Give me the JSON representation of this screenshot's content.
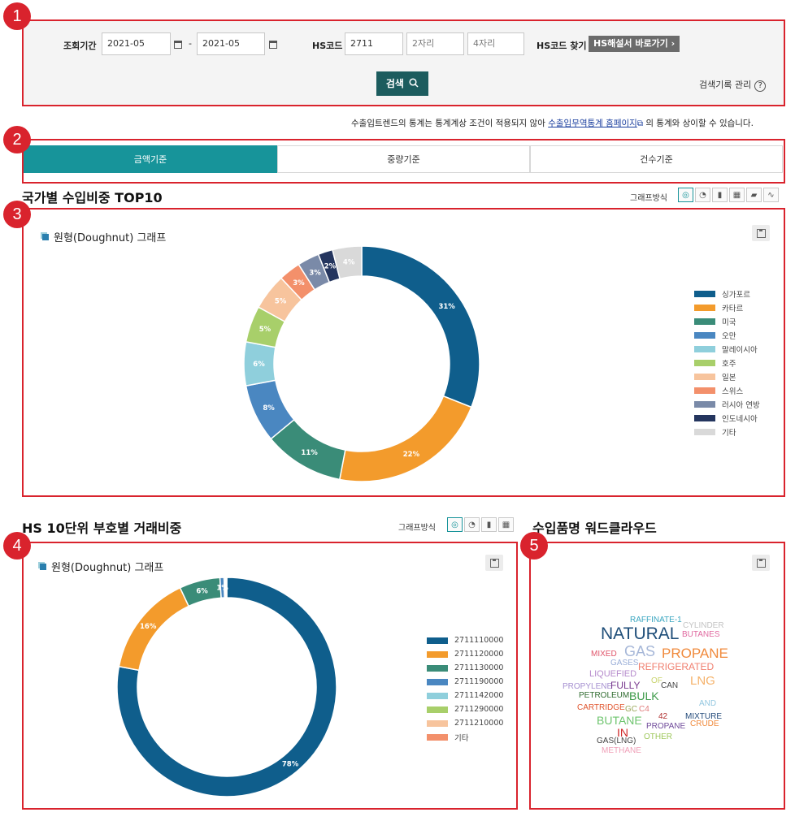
{
  "search": {
    "period_label": "조회기간",
    "date_from": "2021-05",
    "date_sep": "-",
    "date_to": "2021-05",
    "hs_label": "HS코드",
    "hs_value": "2711",
    "hs_2_placeholder": "2자리",
    "hs_4_placeholder": "4자리",
    "hs_find_label": "HS코드 찾기",
    "hs_guide_button": "HS해설서 바로가기 ›",
    "search_button": "검색",
    "history_link": "검색기록 관리",
    "help_glyph": "?"
  },
  "notice": {
    "prefix": "수출입트렌드의 통계는 통계계상 조건이 적용되지 않아",
    "link": "수출입무역통계 홈페이지",
    "suffix": "의 통계와 상이할 수 있습니다."
  },
  "tabs": [
    {
      "label": "금액기준",
      "active": true
    },
    {
      "label": "중량기준",
      "active": false
    },
    {
      "label": "건수기준",
      "active": false
    }
  ],
  "markers": [
    "1",
    "2",
    "3",
    "4",
    "5"
  ],
  "country_section": {
    "title": "국가별 수입비중 TOP10",
    "graph_type_label": "그래프방식",
    "chart_title": "원형(Doughnut) 그래프"
  },
  "hs_section": {
    "title": "HS 10단위 부호별 거래비중",
    "graph_type_label": "그래프방식",
    "chart_title": "원형(Doughnut) 그래프"
  },
  "wordcloud_section": {
    "title": "수입품명 워드클라우드",
    "words": [
      {
        "text": "RAFFINATE-1",
        "color": "#3aa6c0"
      },
      {
        "text": "CYLINDER",
        "color": "#c3c3c3"
      },
      {
        "text": "NATURAL",
        "color": "#1f4e79"
      },
      {
        "text": "BUTANES",
        "color": "#e06aa0"
      },
      {
        "text": "GAS",
        "color": "#a6b7d8"
      },
      {
        "text": "PROPANE",
        "color": "#f08a3c"
      },
      {
        "text": "MIXED",
        "color": "#e0566b"
      },
      {
        "text": "GASES",
        "color": "#9aaed8"
      },
      {
        "text": "REFRIGERATED",
        "color": "#f07f6f"
      },
      {
        "text": "LIQUEFIED",
        "color": "#b58acc"
      },
      {
        "text": "OF",
        "color": "#c8d36b"
      },
      {
        "text": "CAN",
        "color": "#444444"
      },
      {
        "text": "LNG",
        "color": "#f5b26a"
      },
      {
        "text": "PROPYLENE",
        "color": "#a58fd0"
      },
      {
        "text": "FULLY",
        "color": "#7a3b8f"
      },
      {
        "text": "PETROLEUM",
        "color": "#2f6b2f"
      },
      {
        "text": "BULK",
        "color": "#3e9b4a"
      },
      {
        "text": "AND",
        "color": "#93c7e0"
      },
      {
        "text": "CARTRIDGE",
        "color": "#e0552e"
      },
      {
        "text": "GC",
        "color": "#9aa85a"
      },
      {
        "text": "C4",
        "color": "#e07b7b"
      },
      {
        "text": "42",
        "color": "#b03030"
      },
      {
        "text": "MIXTURE",
        "color": "#234a7a"
      },
      {
        "text": "BUTANE",
        "color": "#6dc46d"
      },
      {
        "text": "PROPANE",
        "color": "#6f4a9a"
      },
      {
        "text": "CRUDE",
        "color": "#f08a3c"
      },
      {
        "text": "IN",
        "color": "#d02a2a"
      },
      {
        "text": "OTHER",
        "color": "#9dc75b"
      },
      {
        "text": "GAS(LNG)",
        "color": "#444444"
      },
      {
        "text": "METHANE",
        "color": "#f0a0b8"
      }
    ]
  },
  "chart_data": [
    {
      "type": "pie",
      "series": [
        {
          "name": "싱가포르",
          "value": 31,
          "label": "31%",
          "color": "#0f5e8c"
        },
        {
          "name": "카타르",
          "value": 22,
          "label": "22%",
          "color": "#f39b2c"
        },
        {
          "name": "미국",
          "value": 11,
          "label": "11%",
          "color": "#3a8c78"
        },
        {
          "name": "오만",
          "value": 8,
          "label": "8%",
          "color": "#4a87c1"
        },
        {
          "name": "말레이시아",
          "value": 6,
          "label": "6%",
          "color": "#8fcfdc"
        },
        {
          "name": "호주",
          "value": 5,
          "label": "5%",
          "color": "#a8cf6a"
        },
        {
          "name": "일본",
          "value": 5,
          "label": "5%",
          "color": "#f7c49d"
        },
        {
          "name": "스위스",
          "value": 3,
          "label": "3%",
          "color": "#f3906b"
        },
        {
          "name": "러시아 연방",
          "value": 3,
          "label": "3%",
          "color": "#7a8aa8"
        },
        {
          "name": "인도네시아",
          "value": 2,
          "label": "2%",
          "color": "#24355e"
        },
        {
          "name": "기타",
          "value": 4,
          "label": "4%",
          "color": "#d9d9d9"
        }
      ]
    },
    {
      "type": "pie",
      "series": [
        {
          "name": "2711110000",
          "value": 78,
          "label": "78%",
          "color": "#0f5e8c"
        },
        {
          "name": "2711120000",
          "value": 15,
          "label": "16%",
          "color": "#f39b2c"
        },
        {
          "name": "2711130000",
          "value": 6,
          "label": "6%",
          "color": "#3a8c78"
        },
        {
          "name": "2711190000",
          "value": 0.6,
          "label": "1%",
          "color": "#4a87c1"
        },
        {
          "name": "2711142000",
          "value": 0.2,
          "label": "",
          "color": "#8fcfdc"
        },
        {
          "name": "2711290000",
          "value": 0.1,
          "label": "",
          "color": "#a8cf6a"
        },
        {
          "name": "2711210000",
          "value": 0.05,
          "label": "",
          "color": "#f7c49d"
        },
        {
          "name": "기타",
          "value": 0.05,
          "label": "",
          "color": "#f3906b"
        }
      ]
    }
  ]
}
